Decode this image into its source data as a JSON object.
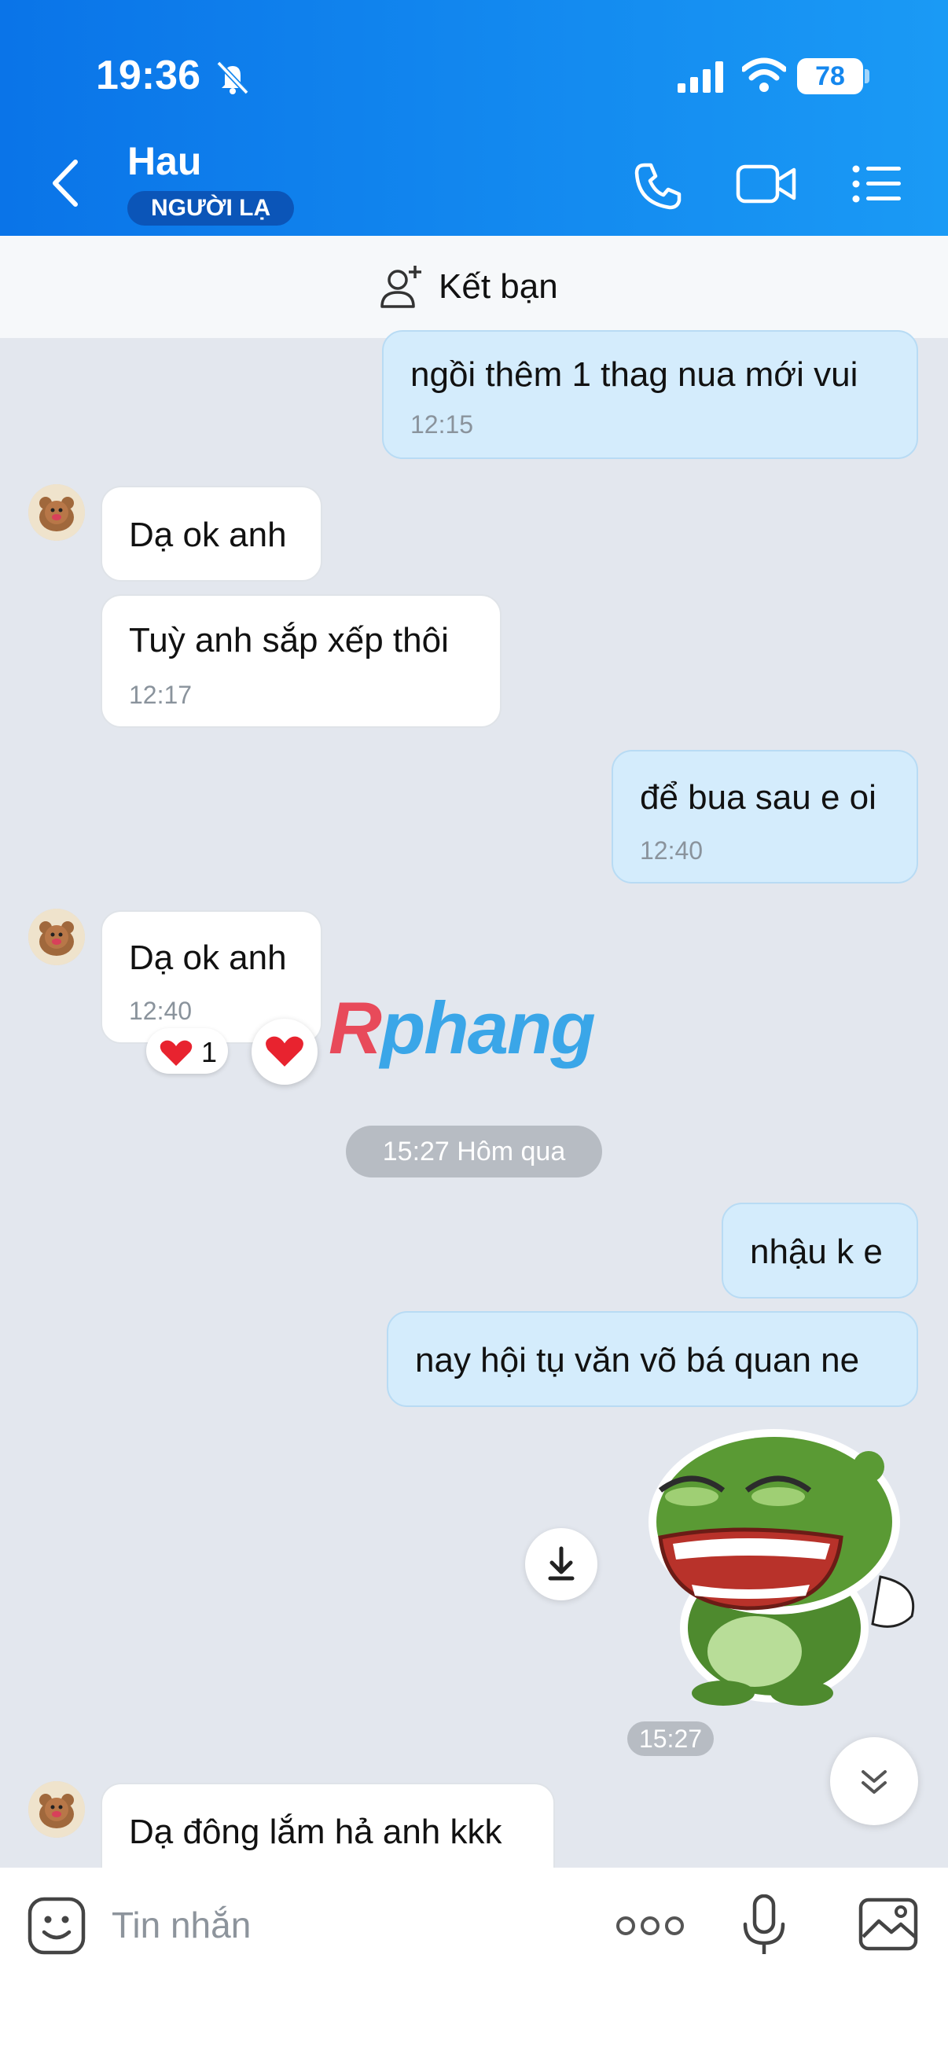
{
  "status_bar": {
    "time": "19:36",
    "battery": "78"
  },
  "header": {
    "contact_name": "Hau",
    "badge": "NGƯỜI LẠ"
  },
  "add_friend": {
    "label": "Kết bạn"
  },
  "messages": [
    {
      "text": "ngồi thêm 1 thag nua mới vui",
      "time": "12:15"
    },
    {
      "text": "Dạ ok anh"
    },
    {
      "text": "Tuỳ anh sắp xếp thôi",
      "time": "12:17"
    },
    {
      "text": "để bua sau e oi",
      "time": "12:40"
    },
    {
      "text": "Dạ ok anh",
      "time": "12:40"
    },
    {
      "text": "nhậu k e"
    },
    {
      "text": "nay hội tụ văn võ bá quan ne"
    },
    {
      "text": "Dạ đông lắm hả anh kkk"
    }
  ],
  "reaction": {
    "count": "1"
  },
  "watermark": {
    "r": "R",
    "rest": "phang"
  },
  "date_divider": "15:27 Hôm qua",
  "sticker_time": "15:27",
  "composer": {
    "placeholder": "Tin nhắn"
  },
  "colors": {
    "header": "#1587ee",
    "out_bubble": "#d4ecfc",
    "heart": "#e8232f"
  }
}
